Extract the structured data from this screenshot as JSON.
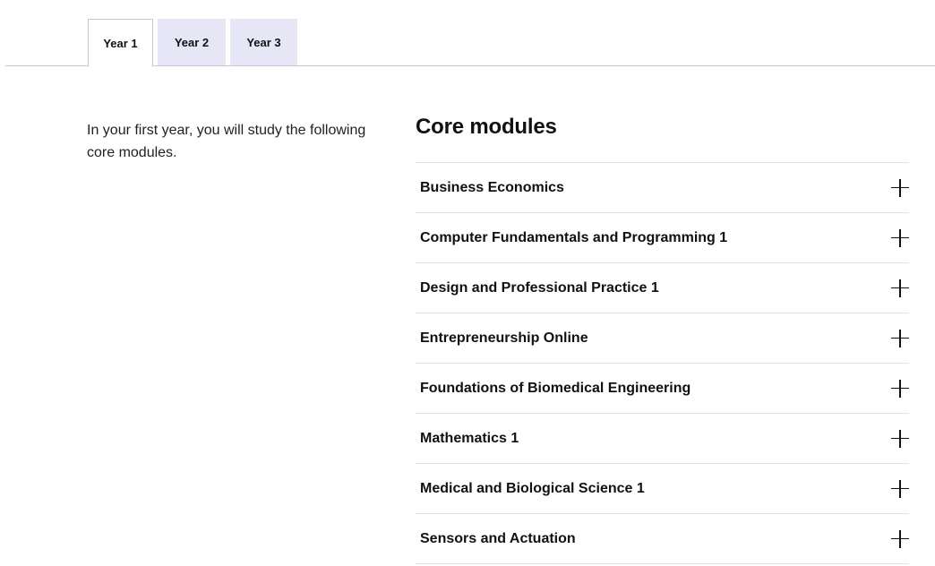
{
  "tabs": [
    {
      "label": "Year 1",
      "active": true
    },
    {
      "label": "Year 2",
      "active": false
    },
    {
      "label": "Year 3",
      "active": false
    }
  ],
  "intro": "In your first year, you will study the following core modules.",
  "core_modules": {
    "heading": "Core modules",
    "items": [
      {
        "title": "Business Economics",
        "icon": "plus-icon"
      },
      {
        "title": "Computer Fundamentals and Programming 1",
        "icon": "plus-icon"
      },
      {
        "title": "Design and Professional Practice 1",
        "icon": "plus-icon"
      },
      {
        "title": "Entrepreneurship Online",
        "icon": "plus-icon"
      },
      {
        "title": "Foundations of Biomedical Engineering",
        "icon": "plus-icon"
      },
      {
        "title": "Mathematics 1",
        "icon": "plus-icon"
      },
      {
        "title": "Medical and Biological Science 1",
        "icon": "plus-icon"
      },
      {
        "title": "Sensors and Actuation",
        "icon": "plus-icon"
      }
    ]
  },
  "colors": {
    "tab_inactive_bg": "#e6e6f7",
    "divider": "#e3e3e3",
    "text": "#111111"
  }
}
